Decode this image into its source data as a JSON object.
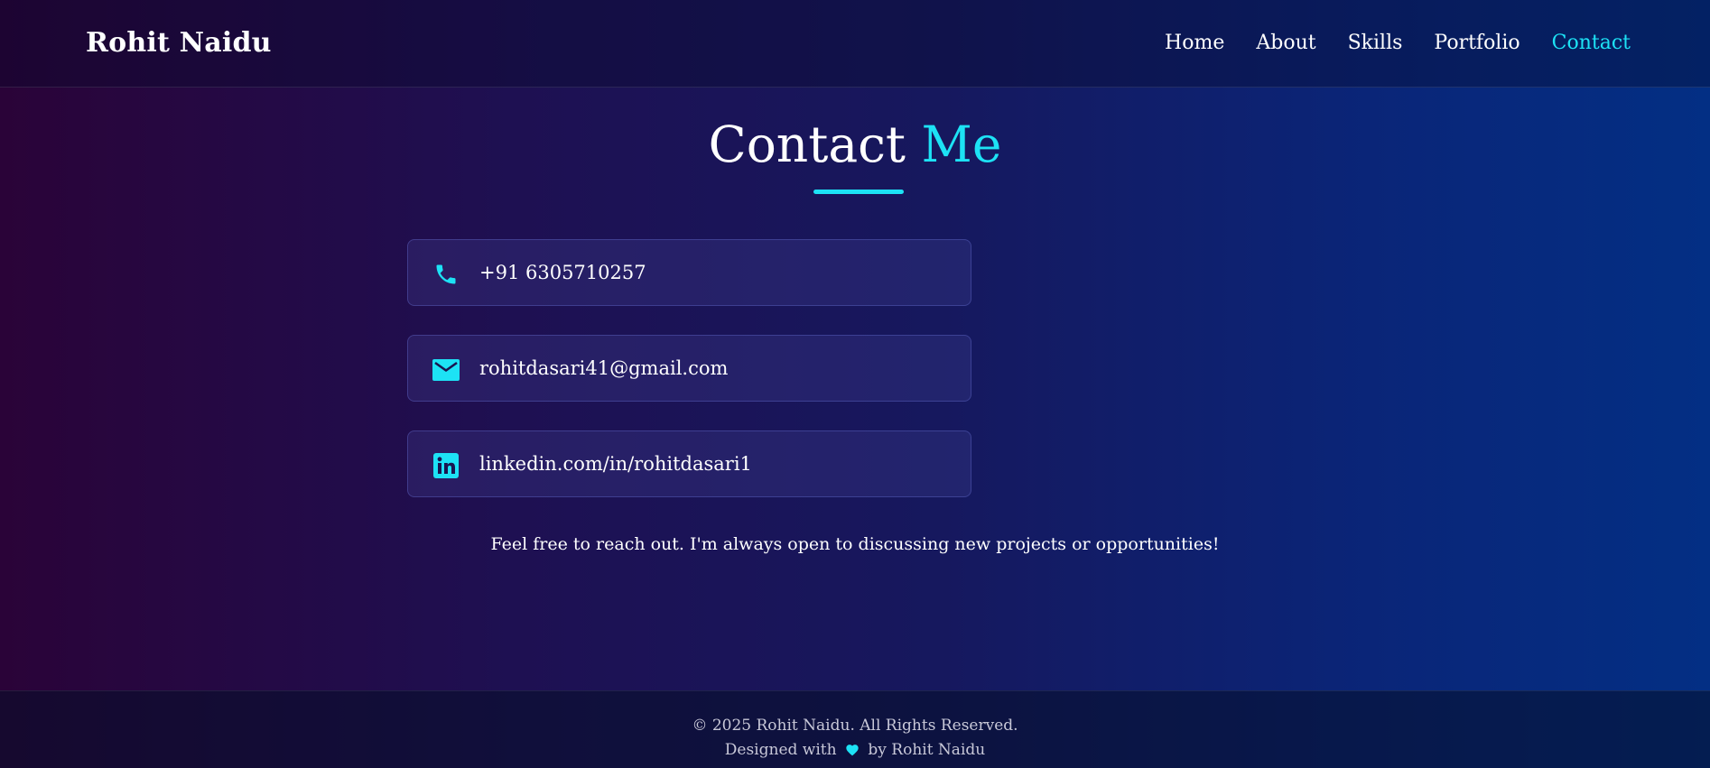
{
  "header": {
    "logo": "Rohit Naidu",
    "nav": [
      {
        "label": "Home"
      },
      {
        "label": "About"
      },
      {
        "label": "Skills"
      },
      {
        "label": "Portfolio"
      },
      {
        "label": "Contact",
        "active": true
      }
    ]
  },
  "contact": {
    "title_main": "Contact",
    "title_accent": "Me",
    "items": [
      {
        "icon": "phone-icon",
        "value": "+91 6305710257"
      },
      {
        "icon": "email-icon",
        "value": "rohitdasari41@gmail.com"
      },
      {
        "icon": "linkedin-icon",
        "value": "linkedin.com/in/rohitdasari1"
      }
    ],
    "note": "Feel free to reach out. I'm always open to discussing new projects or opportunities!"
  },
  "footer": {
    "copyright": "© 2025 Rohit Naidu. All Rights Reserved.",
    "designed_prefix": "Designed with",
    "designed_suffix": "by Rohit Naidu"
  },
  "colors": {
    "accent": "#1de2f5",
    "text": "#ffffff"
  }
}
